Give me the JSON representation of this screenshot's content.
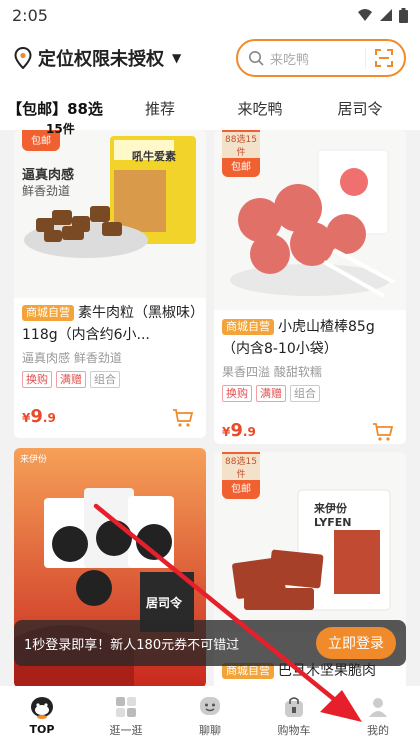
{
  "status": {
    "time": "2:05"
  },
  "header": {
    "location": "定位权限未授权",
    "search_placeholder": "来吃鸭"
  },
  "tabs": [
    {
      "label": "【包邮】88选",
      "active": true
    },
    {
      "label": "推荐"
    },
    {
      "label": "来吃鸭"
    },
    {
      "label": "居司令"
    }
  ],
  "tab_sub": "15件",
  "products": [
    {
      "corner": {
        "line1": "",
        "line2": "包邮"
      },
      "badge": "商城自营",
      "title": "素牛肉粒（黑椒味）118g（内含约6小...",
      "desc": "逼真肉感 鲜香劲道",
      "chips": [
        "换购",
        "满赠",
        "组合"
      ],
      "price_symbol": "¥",
      "price_int": "9",
      "price_dec": ".9",
      "img_text": [
        "逼真肉感",
        "鲜香劲道"
      ],
      "pkg_text": "吼牛爱素"
    },
    {
      "corner": {
        "line1": "88选15件",
        "line2": "包邮"
      },
      "badge": "商城自营",
      "title": "小虎山楂棒85g（内含8-10小袋）",
      "desc": "果香四溢 酸甜软糯",
      "chips": [
        "换购",
        "满赠",
        "组合"
      ],
      "price_symbol": "¥",
      "price_int": "9",
      "price_dec": ".9"
    },
    {
      "img_text": [
        "来伊份",
        "居司令"
      ]
    },
    {
      "corner": {
        "line1": "88选15件",
        "line2": "包邮"
      },
      "badge": "商城自营",
      "title": "巴旦木坚果脆肉",
      "pkg_text": "来伊份 LYFEN"
    }
  ],
  "banner": {
    "text": "1秒登录即享！新人180元券不可错过",
    "button": "立即登录"
  },
  "nav": [
    {
      "label": "TOP",
      "icon": "top-mascot-icon",
      "active": true
    },
    {
      "label": "逛一逛",
      "icon": "browse-icon"
    },
    {
      "label": "聊聊",
      "icon": "chat-icon"
    },
    {
      "label": "购物车",
      "icon": "cart-icon"
    },
    {
      "label": "我的",
      "icon": "profile-icon"
    }
  ],
  "colors": {
    "accent": "#f08a2a",
    "price": "#e84a2a",
    "badge": "#f2a33a",
    "arrow": "#e6202a"
  }
}
